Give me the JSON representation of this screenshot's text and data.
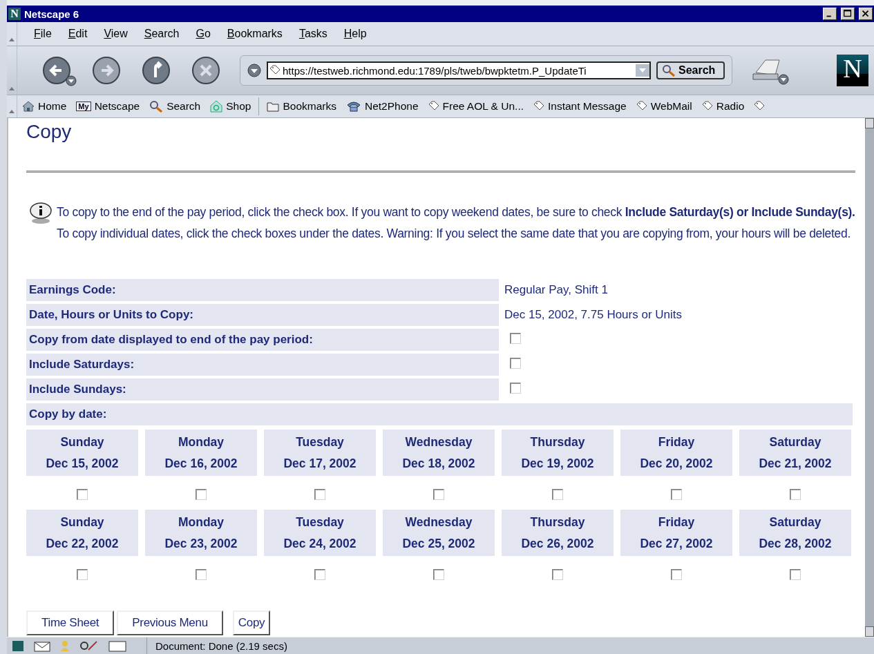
{
  "window": {
    "title": "Netscape 6",
    "logo_letter": "N"
  },
  "menu": [
    "File",
    "Edit",
    "View",
    "Search",
    "Go",
    "Bookmarks",
    "Tasks",
    "Help"
  ],
  "navigation": {
    "url": "https://testweb.richmond.edu:1789/pls/tweb/bwpktetm.P_UpdateTi",
    "search_button": "Search",
    "logo_letter": "N"
  },
  "personal_toolbar": [
    {
      "kind": "home",
      "label": "Home"
    },
    {
      "kind": "my",
      "label": "Netscape",
      "badge": "My"
    },
    {
      "kind": "search",
      "label": "Search"
    },
    {
      "kind": "shop",
      "label": "Shop"
    },
    {
      "kind": "folder",
      "label": "Bookmarks"
    },
    {
      "kind": "phone",
      "label": "Net2Phone"
    },
    {
      "kind": "bookmark",
      "label": "Free AOL & Un..."
    },
    {
      "kind": "bookmark",
      "label": "Instant Message"
    },
    {
      "kind": "bookmark",
      "label": "WebMail"
    },
    {
      "kind": "bookmark",
      "label": "Radio"
    },
    {
      "kind": "bookmark"
    }
  ],
  "page": {
    "heading": "Copy",
    "info": "To copy to the end of the pay period, click the check box. If you want to copy weekend dates, be sure to check **Include Saturday(s) or Include Sunday(s).** To copy individual dates, click the check boxes under the dates. Warning: If you select the same date that you are copying from, your hours will be deleted.",
    "fields": [
      {
        "kind": "text",
        "label": "Earnings Code:",
        "value": "Regular Pay, Shift 1"
      },
      {
        "kind": "text",
        "label": "Date, Hours or Units to Copy:",
        "value": "Dec 15, 2002, 7.75 Hours or Units"
      },
      {
        "kind": "checkbox",
        "label": "Copy from date displayed to end of the pay period:",
        "checked": false
      },
      {
        "kind": "checkbox",
        "label": "Include Saturdays:",
        "checked": false
      },
      {
        "kind": "checkbox",
        "label": "Include Sundays:",
        "checked": false
      }
    ],
    "copy_by_date_label": "Copy by date:",
    "weeks": [
      [
        {
          "day": "Sunday",
          "date": "Dec 15, 2002",
          "checked": false
        },
        {
          "day": "Monday",
          "date": "Dec 16, 2002",
          "checked": false
        },
        {
          "day": "Tuesday",
          "date": "Dec 17, 2002",
          "checked": false
        },
        {
          "day": "Wednesday",
          "date": "Dec 18, 2002",
          "checked": false
        },
        {
          "day": "Thursday",
          "date": "Dec 19, 2002",
          "checked": false
        },
        {
          "day": "Friday",
          "date": "Dec 20, 2002",
          "checked": false
        },
        {
          "day": "Saturday",
          "date": "Dec 21, 2002",
          "checked": false
        }
      ],
      [
        {
          "day": "Sunday",
          "date": "Dec 22, 2002",
          "checked": false
        },
        {
          "day": "Monday",
          "date": "Dec 23, 2002",
          "checked": false
        },
        {
          "day": "Tuesday",
          "date": "Dec 24, 2002",
          "checked": false
        },
        {
          "day": "Wednesday",
          "date": "Dec 25, 2002",
          "checked": false
        },
        {
          "day": "Thursday",
          "date": "Dec 26, 2002",
          "checked": false
        },
        {
          "day": "Friday",
          "date": "Dec 27, 2002",
          "checked": false
        },
        {
          "day": "Saturday",
          "date": "Dec 28, 2002",
          "checked": false
        }
      ]
    ],
    "buttons": [
      "Time Sheet",
      "Previous Menu",
      "Copy"
    ]
  },
  "status_bar": {
    "text": "Document: Done (2.19 secs)"
  }
}
